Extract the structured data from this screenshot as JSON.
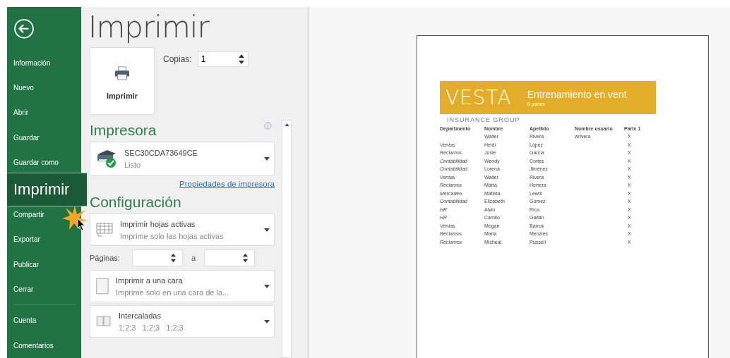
{
  "sidebar": {
    "items": [
      {
        "label": "Información",
        "selected": false
      },
      {
        "label": "Nuevo",
        "selected": false
      },
      {
        "label": "Abrir",
        "selected": false
      },
      {
        "label": "Guardar",
        "selected": false
      },
      {
        "label": "Guardar como",
        "selected": false
      },
      {
        "label": "Imprimir",
        "selected": true
      },
      {
        "label": "Compartir",
        "selected": false
      },
      {
        "label": "Exportar",
        "selected": false
      },
      {
        "label": "Publicar",
        "selected": false
      },
      {
        "label": "Cerrar",
        "selected": false
      }
    ],
    "bottom_items": [
      {
        "label": "Cuenta",
        "selected": false
      },
      {
        "label": "Comentarios",
        "selected": false
      }
    ]
  },
  "title": "Imprimir",
  "print_button": "Imprimir",
  "copies": {
    "label": "Copias:",
    "value": "1"
  },
  "printer": {
    "heading": "Impresora",
    "name": "SEC30CDA73649CE",
    "status": "Listo",
    "properties_link": "Propiedades de impresora"
  },
  "settings": {
    "heading": "Configuración",
    "items": [
      {
        "kind": "dropdown",
        "title": "Imprimir hojas activas",
        "subtitle": "Imprime solo las hojas activas"
      },
      {
        "kind": "pages",
        "label": "Páginas:",
        "separator": "a"
      },
      {
        "kind": "dropdown",
        "title": "Imprimir a una cara",
        "subtitle": "Imprime solo en una cara de la..."
      },
      {
        "kind": "dropdown",
        "title": "Intercaladas",
        "subtitle": "1;2;3   1;2;3   1;2;3"
      }
    ]
  },
  "preview": {
    "banner_logo": "VESTA",
    "banner_title": "Entrenamiento en vent",
    "banner_subtitle": "6 partes",
    "company": "INSURANCE  GROUP",
    "columns": [
      "Departmento",
      "Nombre",
      "Apellido",
      "Nombre usuario",
      "Parte 1"
    ],
    "rows": [
      [
        "",
        "Walter",
        "Rivera",
        "wrivera",
        "X"
      ],
      [
        "Ventas",
        "Heidi",
        "López",
        "",
        "X"
      ],
      [
        "Reclamos",
        "Josie",
        "García",
        "",
        "X"
      ],
      [
        "Contabilidad",
        "Wendy",
        "Cortes",
        "",
        "X"
      ],
      [
        "Contabilidad",
        "Lorena",
        "Jiménez",
        "",
        "X"
      ],
      [
        "Ventas",
        "Walter",
        "Rivera",
        "",
        "X"
      ],
      [
        "Reclamos",
        "Marta",
        "Herrera",
        "",
        "X"
      ],
      [
        "Mercadeo",
        "Matilda",
        "Lewis",
        "",
        "X"
      ],
      [
        "Contabilidad",
        "Elizabeth",
        "Gómez",
        "",
        "X"
      ],
      [
        "HR",
        "Alvin",
        "Ríos",
        "",
        "X"
      ],
      [
        "HR",
        "Camilo",
        "Gaitán",
        "",
        "X"
      ],
      [
        "Ventas",
        "Megan",
        "Barros",
        "",
        "X"
      ],
      [
        "Reclamos",
        "Maria",
        "Menzies",
        "",
        "X"
      ],
      [
        "Reclamos",
        "Micheal",
        "Russell",
        "",
        "X"
      ]
    ]
  }
}
